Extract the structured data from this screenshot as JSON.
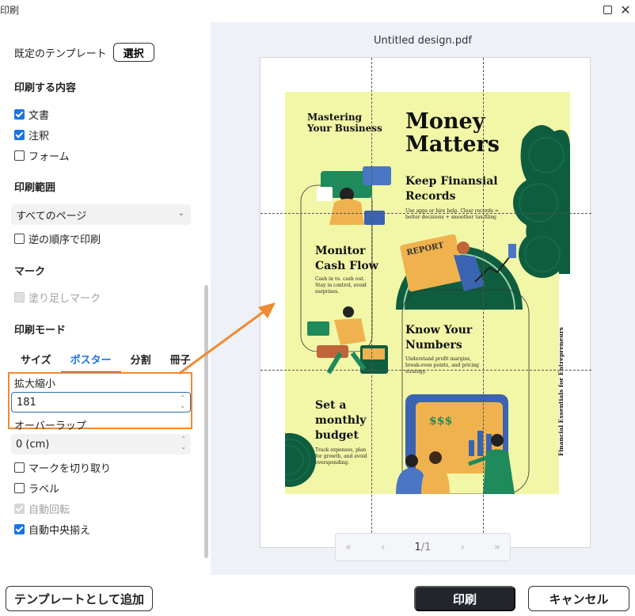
{
  "window": {
    "title": "印刷"
  },
  "left": {
    "template_label": "既定のテンプレート",
    "select_button": "選択",
    "content_heading": "印刷する内容",
    "content_options": [
      {
        "label": "文書",
        "checked": true
      },
      {
        "label": "注釈",
        "checked": true
      },
      {
        "label": "フォーム",
        "checked": false
      }
    ],
    "range_heading": "印刷範囲",
    "range_value": "すべてのページ",
    "reverse_label": "逆の順序で印刷",
    "marks_heading": "マーク",
    "bleed_label": "塗り足しマーク",
    "mode_heading": "印刷モード",
    "tabs": [
      "サイズ",
      "ポスター",
      "分割",
      "冊子"
    ],
    "active_tab": "ポスター",
    "scale_label": "拡大縮小",
    "scale_value": "181",
    "overlap_label": "オーバーラップ",
    "overlap_value": "0 (cm)",
    "cut_marks_label": "マークを切り取り",
    "label_label": "ラベル",
    "auto_rotate_label": "自動回転",
    "auto_center_label": "自動中央揃え"
  },
  "preview": {
    "doc_name": "Untitled design.pdf",
    "poster": {
      "mastering": "Mastering",
      "your_business": "Your Business",
      "money": "Money",
      "matters": "Matters",
      "keep_1": "Keep Finansial",
      "keep_2": "Records",
      "keep_desc_1": "Use apps or hire help. Clear records =",
      "keep_desc_2": "better decisions + smoother tax filing",
      "report": "REPORT",
      "monitor_1": "Monitor",
      "monitor_2": "Cash Flow",
      "monitor_desc_1": "Cash in vs. cash out.",
      "monitor_desc_2": "Stay in control, avoid",
      "monitor_desc_3": "surprises.",
      "know_1": "Know Your",
      "know_2": "Numbers",
      "know_desc_1": "Understand profit margins,",
      "know_desc_2": "break-even points, and pricing",
      "know_desc_3": "strategy.",
      "set_1": "Set a",
      "set_2": "monthly",
      "set_3": "budget",
      "set_desc_1": "Track expenses, plan",
      "set_desc_2": "for growth, and avoid",
      "set_desc_3": "overspending.",
      "dollars": "$$$",
      "side_title": "Financial Essentials for Entrepreneurs"
    },
    "pager": {
      "first": "«",
      "prev": "‹",
      "current": "1",
      "total": "/1",
      "next": "›",
      "last": "»"
    }
  },
  "footer": {
    "add_template": "テンプレートとして追加",
    "print": "印刷",
    "cancel": "キャンセル"
  },
  "colors": {
    "accent": "#1a73e8",
    "highlight": "#f08a33",
    "poster_bg": "#f1f7a7",
    "poster_green": "#0e5d3f"
  }
}
